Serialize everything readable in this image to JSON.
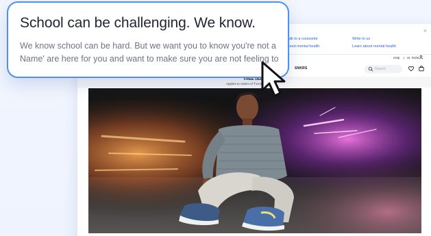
{
  "callout": {
    "title": "School can be challenging. We know.",
    "body_line1": "We know school can be hard. But we want you to know you're not a",
    "body_line2": "Name' are here for you and want to make sure you are not feeling to"
  },
  "help_panel": {
    "link_counselor": "Talk to a counselor",
    "link_write": "Write to us",
    "link_mental_health_1": "about mental health",
    "link_mental_health_2": "Learn about mental health",
    "close_icon": "×"
  },
  "topbar": {
    "help": "Help",
    "separator": "|",
    "greeting": "Hi, Rohit"
  },
  "nav": {
    "brand": "SNKRS",
    "search_placeholder": "Search"
  },
  "promo": {
    "title": "FREE DELIVERY",
    "subtitle": "Applies to orders of ₹14,000 or more."
  },
  "colors": {
    "accent": "#4a90f0",
    "link": "#2d5fd6"
  }
}
